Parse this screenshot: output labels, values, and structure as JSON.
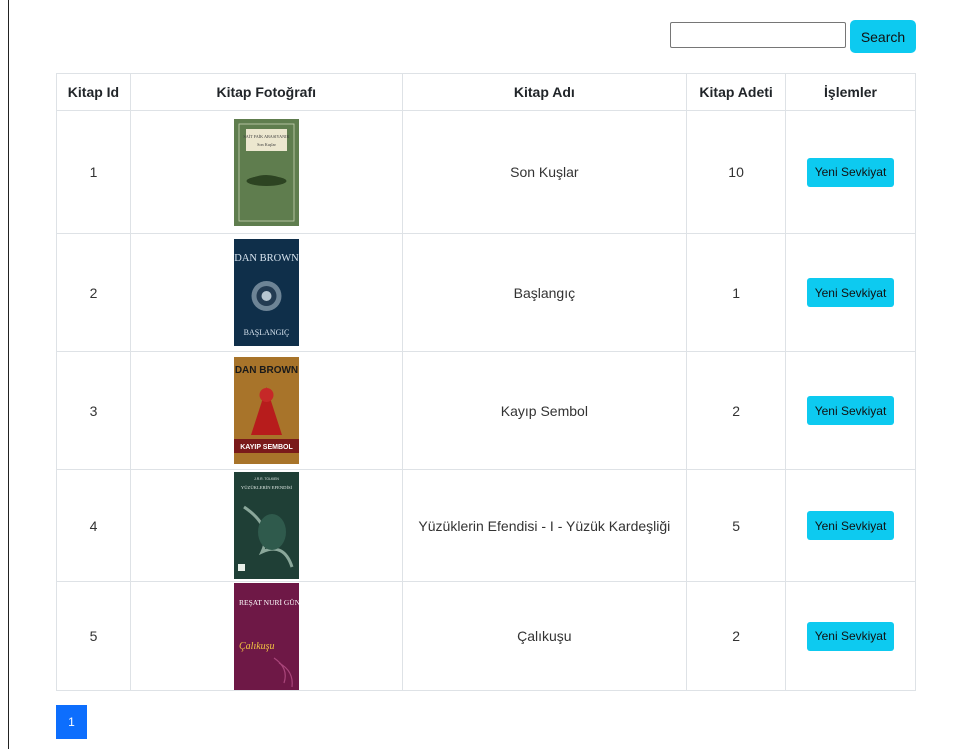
{
  "search": {
    "button_label": "Search",
    "value": "",
    "placeholder": ""
  },
  "table": {
    "headers": [
      "Kitap Id",
      "Kitap Fotoğrafı",
      "Kitap Adı",
      "Kitap Adeti",
      "İşlemler"
    ],
    "rows": [
      {
        "id": "1",
        "name": "Son Kuşlar",
        "count": "10",
        "action": "Yeni Sevkiyat",
        "cover": {
          "author": "SAİT FAİK ABASIYANIK",
          "title": "Son Kuşlar",
          "bg": "#5f7d4e",
          "fg": "#f3efd9"
        }
      },
      {
        "id": "2",
        "name": "Başlangıç",
        "count": "1",
        "action": "Yeni Sevkiyat",
        "cover": {
          "author": "DAN BROWN",
          "title": "BAŞLANGIÇ",
          "bg": "#0f2f4a",
          "fg": "#d7e3ee"
        }
      },
      {
        "id": "3",
        "name": "Kayıp Sembol",
        "count": "2",
        "action": "Yeni Sevkiyat",
        "cover": {
          "author": "DAN BROWN",
          "title": "KAYIP SEMBOL",
          "bg": "#a8742a",
          "fg": "#ffffff"
        }
      },
      {
        "id": "4",
        "name": "Yüzüklerin Efendisi - I - Yüzük Kardeşliği",
        "count": "5",
        "action": "Yeni Sevkiyat",
        "cover": {
          "author": "J.R.R. TOLKIEN",
          "title": "YÜZÜKLERİN EFENDİSİ",
          "bg": "#1f3f36",
          "fg": "#dfe8e4"
        }
      },
      {
        "id": "5",
        "name": "Çalıkuşu",
        "count": "2",
        "action": "Yeni Sevkiyat",
        "cover": {
          "author": "REŞAT NURİ GÜNTEKİN",
          "title": "Çalıkuşu",
          "bg": "#6e1846",
          "fg": "#ffffff"
        }
      }
    ]
  },
  "pagination": {
    "current": "1"
  },
  "colors": {
    "accent": "#0dcaf0",
    "pager": "#0d6efd"
  }
}
